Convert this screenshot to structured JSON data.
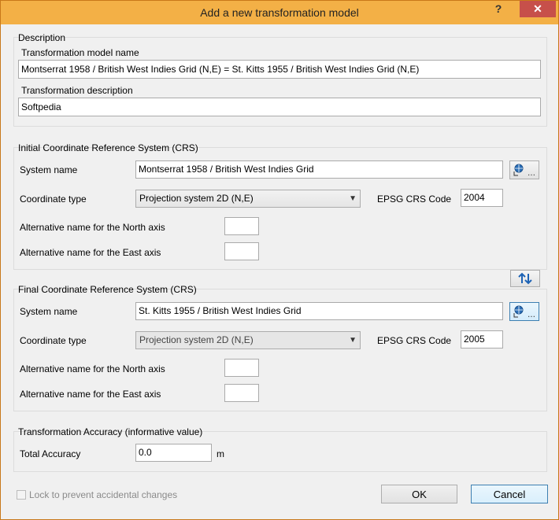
{
  "window": {
    "title": "Add a new transformation model",
    "help": "?",
    "close": "✕"
  },
  "description": {
    "legend": "Description",
    "name_label": "Transformation model name",
    "name_value": "Montserrat 1958 / British West Indies Grid (N,E) = St. Kitts 1955 / British West Indies Grid (N,E)",
    "desc_label": "Transformation description",
    "desc_value": "Softpedia"
  },
  "initial": {
    "legend": "Initial Coordinate Reference System (CRS)",
    "system_label": "System name",
    "system_value": "Montserrat 1958 / British West Indies Grid",
    "coord_label": "Coordinate type",
    "coord_value": "Projection system 2D (N,E)",
    "epsg_label": "EPSG CRS Code",
    "epsg_value": "2004",
    "north_label": "Alternative name for the North axis",
    "north_value": "",
    "east_label": "Alternative name for the East axis",
    "east_value": ""
  },
  "final": {
    "legend": "Final Coordinate Reference System (CRS)",
    "system_label": "System name",
    "system_value": "St. Kitts 1955 / British West Indies Grid",
    "coord_label": "Coordinate type",
    "coord_value": "Projection system 2D (N,E)",
    "epsg_label": "EPSG CRS Code",
    "epsg_value": "2005",
    "north_label": "Alternative name for the North axis",
    "north_value": "",
    "east_label": "Alternative name for the East axis",
    "east_value": ""
  },
  "accuracy": {
    "legend": "Transformation Accuracy (informative value)",
    "label": "Total Accuracy",
    "value": "0.0",
    "unit": "m"
  },
  "footer": {
    "lock_label": "Lock to prevent accidental changes",
    "lock_checked": false,
    "ok": "OK",
    "cancel": "Cancel"
  },
  "icons": {
    "select_globe": "globe-select-icon",
    "swap": "swap-arrows-icon"
  },
  "colors": {
    "titlebar": "#f3b046",
    "close": "#c7504a",
    "accent": "#3c7fb1"
  }
}
